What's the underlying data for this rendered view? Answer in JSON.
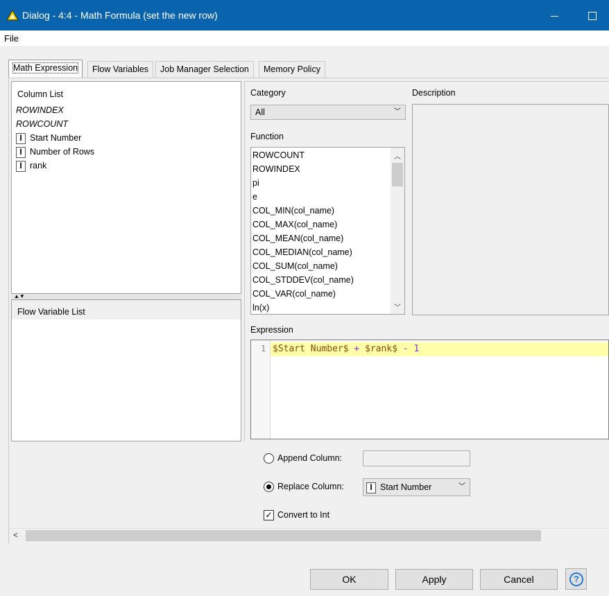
{
  "window": {
    "title": "Dialog - 4:4 - Math Formula (set the new row)"
  },
  "menubar": {
    "file": "File"
  },
  "tabs": [
    {
      "label": "Math Expression"
    },
    {
      "label": "Flow Variables"
    },
    {
      "label": "Job Manager Selection"
    },
    {
      "label": "Memory Policy"
    }
  ],
  "column_list": {
    "header": "Column List",
    "items": [
      {
        "label": "ROWINDEX",
        "type": "special"
      },
      {
        "label": "ROWCOUNT",
        "type": "special"
      },
      {
        "label": "Start Number",
        "type": "int",
        "icon": "I"
      },
      {
        "label": "Number of Rows",
        "type": "int",
        "icon": "I"
      },
      {
        "label": "rank",
        "type": "int",
        "icon": "I"
      }
    ]
  },
  "flow_variable_list": {
    "header": "Flow Variable List"
  },
  "category": {
    "label": "Category",
    "selected": "All"
  },
  "function": {
    "label": "Function",
    "items": [
      "ROWCOUNT",
      "ROWINDEX",
      "pi",
      "e",
      "COL_MIN(col_name)",
      "COL_MAX(col_name)",
      "COL_MEAN(col_name)",
      "COL_MEDIAN(col_name)",
      "COL_SUM(col_name)",
      "COL_STDDEV(col_name)",
      "COL_VAR(col_name)",
      "ln(x)"
    ]
  },
  "description": {
    "label": "Description"
  },
  "expression": {
    "label": "Expression",
    "line_number": "1",
    "tokens": {
      "var1": "$Start Number$",
      "op1": " + ",
      "var2": "$rank$",
      "op2": " - ",
      "num": "1"
    }
  },
  "options": {
    "append_label": "Append Column:",
    "append_value": "",
    "append_checked": false,
    "replace_label": "Replace Column:",
    "replace_value": "Start Number",
    "replace_icon": "I",
    "replace_checked": true,
    "convert_label": "Convert to Int",
    "convert_checked": true
  },
  "buttons": {
    "ok": "OK",
    "apply": "Apply",
    "cancel": "Cancel",
    "help": "?"
  },
  "colors": {
    "titlebar": "#0a64ad",
    "expression_highlight": "#ffffaa"
  }
}
